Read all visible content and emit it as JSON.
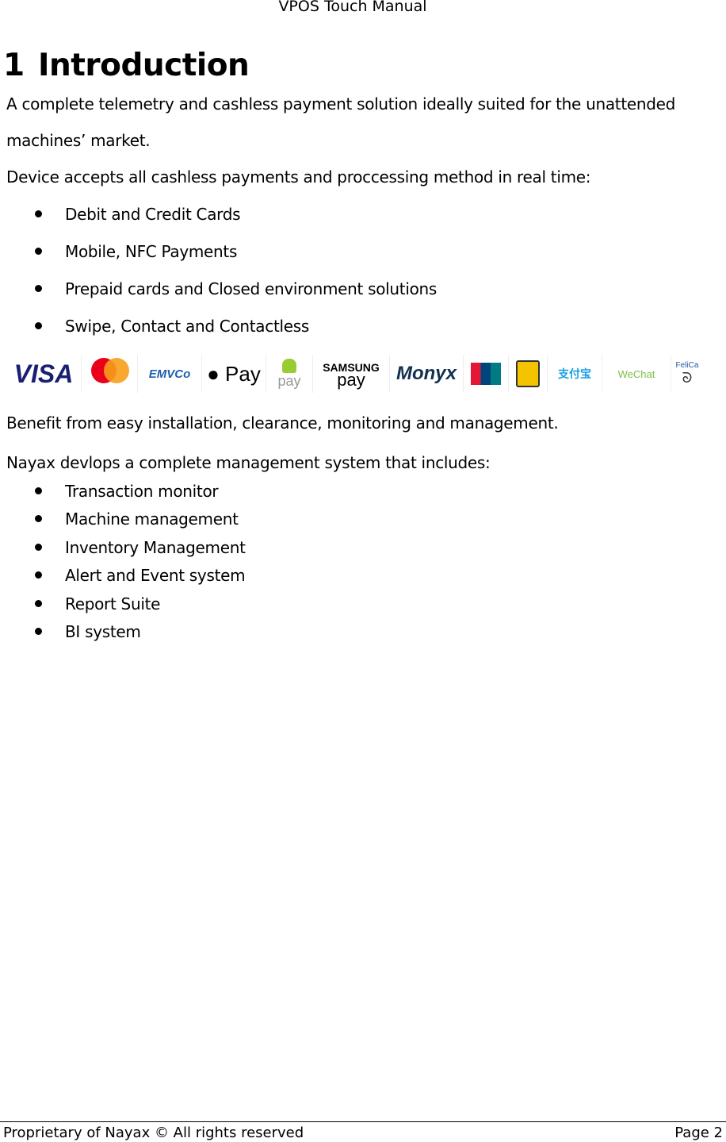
{
  "header": {
    "title": "VPOS Touch Manual"
  },
  "section": {
    "number": "1",
    "title": "Introduction"
  },
  "intro": {
    "line1": "A complete telemetry and cashless payment solution ideally suited for the unattended",
    "line2": "machines’ market.",
    "line3": "Device accepts all cashless payments and proccessing method in real time:"
  },
  "payment_list": [
    "Debit and Credit Cards",
    "Mobile, NFC Payments",
    "Prepaid cards and Closed environment solutions",
    "Swipe, Contact and Contactless"
  ],
  "logos": [
    "VISA",
    "mastercard",
    "EMVCo",
    "Apple Pay",
    "Android pay",
    "SAMSUNG pay",
    "Monyx",
    "UnionPay",
    "Alipay",
    "WeChat",
    "FeliCa"
  ],
  "benefit": "Benefit from easy installation, clearance, monitoring and management.",
  "system_intro": "Nayax devlops a complete management system that includes:",
  "system_list": [
    "Transaction monitor",
    "Machine management",
    "Inventory Management",
    "Alert and Event system",
    "Report Suite",
    "BI system"
  ],
  "footer": {
    "left": "Proprietary of Nayax © All rights reserved",
    "right": "Page 2"
  }
}
